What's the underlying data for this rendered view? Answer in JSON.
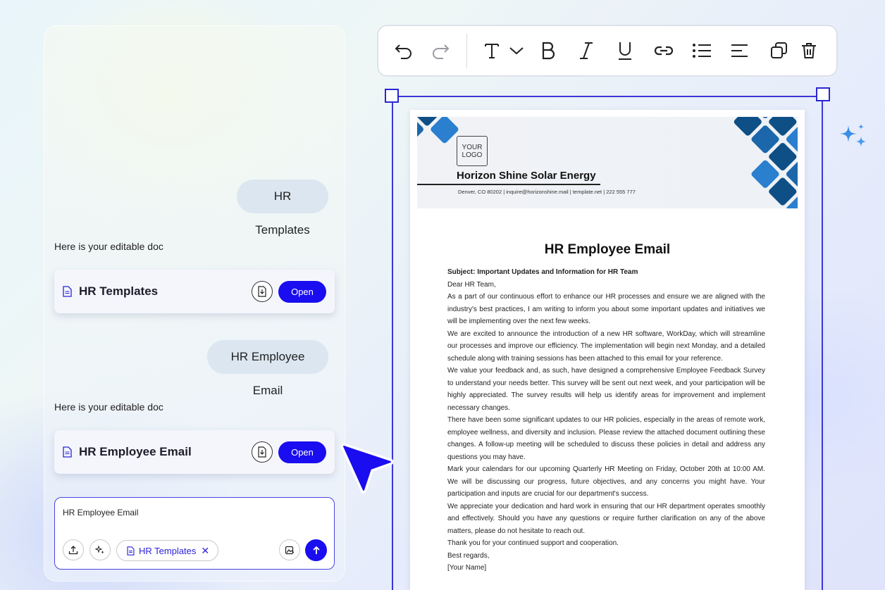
{
  "chat": {
    "messages": [
      {
        "user": "HR Templates",
        "reply": "Here is your editable doc",
        "doc_title": "HR Templates",
        "open_label": "Open"
      },
      {
        "user": "HR Employee Email",
        "reply": "Here is your editable doc",
        "doc_title": "HR Employee Email",
        "open_label": "Open"
      }
    ],
    "input": {
      "value": "HR Employee Email",
      "chip_label": "HR Templates"
    }
  },
  "toolbar": {
    "icons": [
      "undo-icon",
      "redo-icon",
      "text-style-icon",
      "chevron-down-icon",
      "bold-icon",
      "italic-icon",
      "underline-icon",
      "link-icon",
      "bullet-list-icon",
      "align-icon",
      "duplicate-icon",
      "delete-icon"
    ]
  },
  "document": {
    "logo_line1": "YOUR",
    "logo_line2": "LOGO",
    "company": "Horizon Shine Solar Energy",
    "contact": "Denver, CO 80202 | inquire@horizonshine.mail | template.net | 222 555 777",
    "heading": "HR Employee Email",
    "subject": "Subject: Important Updates and Information for HR Team",
    "greeting": "Dear HR Team,",
    "paragraphs": [
      "As a part of our continuous effort to enhance our HR processes and ensure we are aligned with the industry's best practices, I am writing to inform you about some important updates and initiatives we will be implementing over the next few weeks.",
      "We are excited to announce the introduction of a new HR software, WorkDay, which will streamline our processes and improve our efficiency. The implementation will begin next Monday, and a detailed schedule along with training sessions has been attached to this email for your reference.",
      "We value your feedback and, as such, have designed a comprehensive Employee Feedback Survey to understand your needs better. This survey will be sent out next week, and your participation will be highly appreciated. The survey results will help us identify areas for improvement and implement necessary changes.",
      "There have been some significant updates to our HR policies, especially in the areas of remote work, employee wellness, and diversity and inclusion. Please review the attached document outlining these changes. A follow-up meeting will be scheduled to discuss these policies in detail and address any questions you may have.",
      "Mark your calendars for our upcoming Quarterly HR Meeting on Friday, October 20th at 10:00 AM. We will be discussing our progress, future objectives, and any concerns you might have. Your participation and inputs are crucial for our department's success.",
      "We appreciate your dedication and hard work in ensuring that our HR department operates smoothly and effectively. Should you have any questions or require further clarification on any of the above matters, please do not hesitate to reach out."
    ],
    "thanks": "Thank you for your continued support and cooperation.",
    "closing": "Best regards,",
    "name": "[Your Name]"
  },
  "colors": {
    "accent": "#1a0df0",
    "selection": "#3a36d6",
    "tile_dark": "#0e4f86",
    "tile_light": "#2a7fcf"
  }
}
